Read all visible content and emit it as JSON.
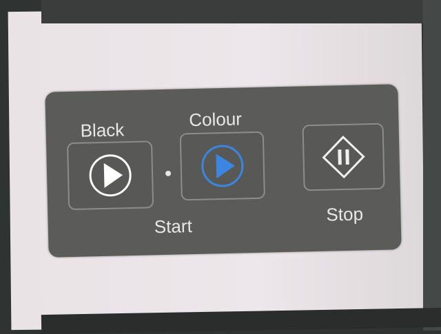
{
  "panel": {
    "black_label": "Black",
    "colour_label": "Colour",
    "start_label": "Start",
    "stop_label": "Stop",
    "buttons": [
      {
        "id": "black-start",
        "icon": "play-circle-icon",
        "color": "#ffffff"
      },
      {
        "id": "colour-start",
        "icon": "play-circle-icon",
        "color": "#3a86e0"
      },
      {
        "id": "stop",
        "icon": "diamond-pause-icon",
        "color": "#ffffff"
      }
    ]
  }
}
